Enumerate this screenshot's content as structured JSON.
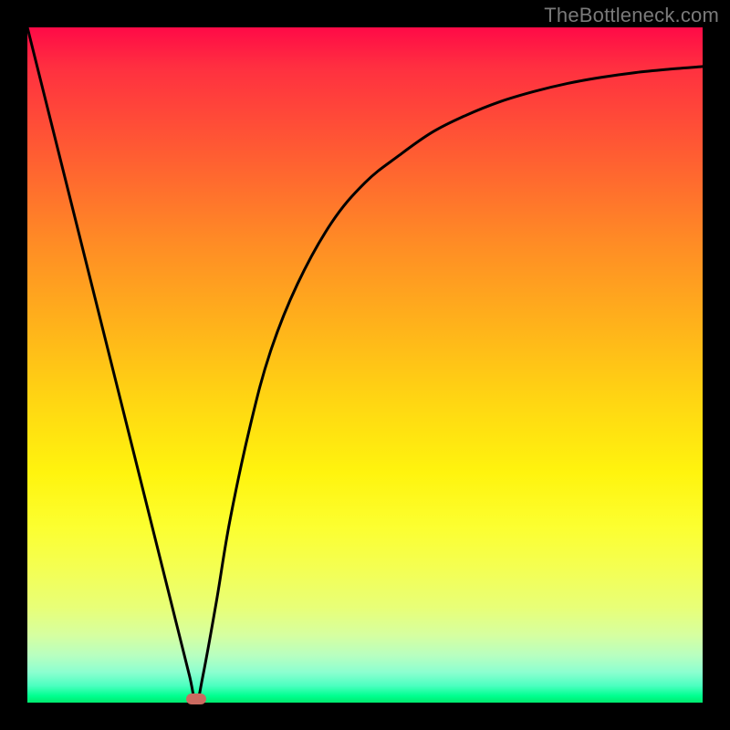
{
  "watermark": "TheBottleneck.com",
  "colors": {
    "frame": "#000000",
    "gradient_top": "#ff0a47",
    "gradient_bottom": "#00ea6e",
    "curve": "#000000",
    "dot": "#cb6a60",
    "watermark": "#7a7a7a"
  },
  "chart_data": {
    "type": "line",
    "title": "",
    "xlabel": "",
    "ylabel": "",
    "xlim": [
      0,
      100
    ],
    "ylim": [
      0,
      100
    ],
    "grid": false,
    "legend": false,
    "series": [
      {
        "name": "bottleneck-curve",
        "x": [
          0,
          5,
          10,
          15,
          20,
          22,
          24,
          25,
          26,
          28,
          30,
          33,
          36,
          40,
          45,
          50,
          55,
          60,
          65,
          70,
          75,
          80,
          85,
          90,
          95,
          100
        ],
        "values": [
          100,
          80,
          60,
          40,
          20,
          12,
          4,
          0,
          4,
          15,
          27,
          41,
          52,
          62,
          71,
          77,
          81,
          84.5,
          87,
          89,
          90.5,
          91.7,
          92.6,
          93.3,
          93.8,
          94.2
        ]
      }
    ],
    "marker": {
      "x": 25,
      "y": 0
    }
  }
}
